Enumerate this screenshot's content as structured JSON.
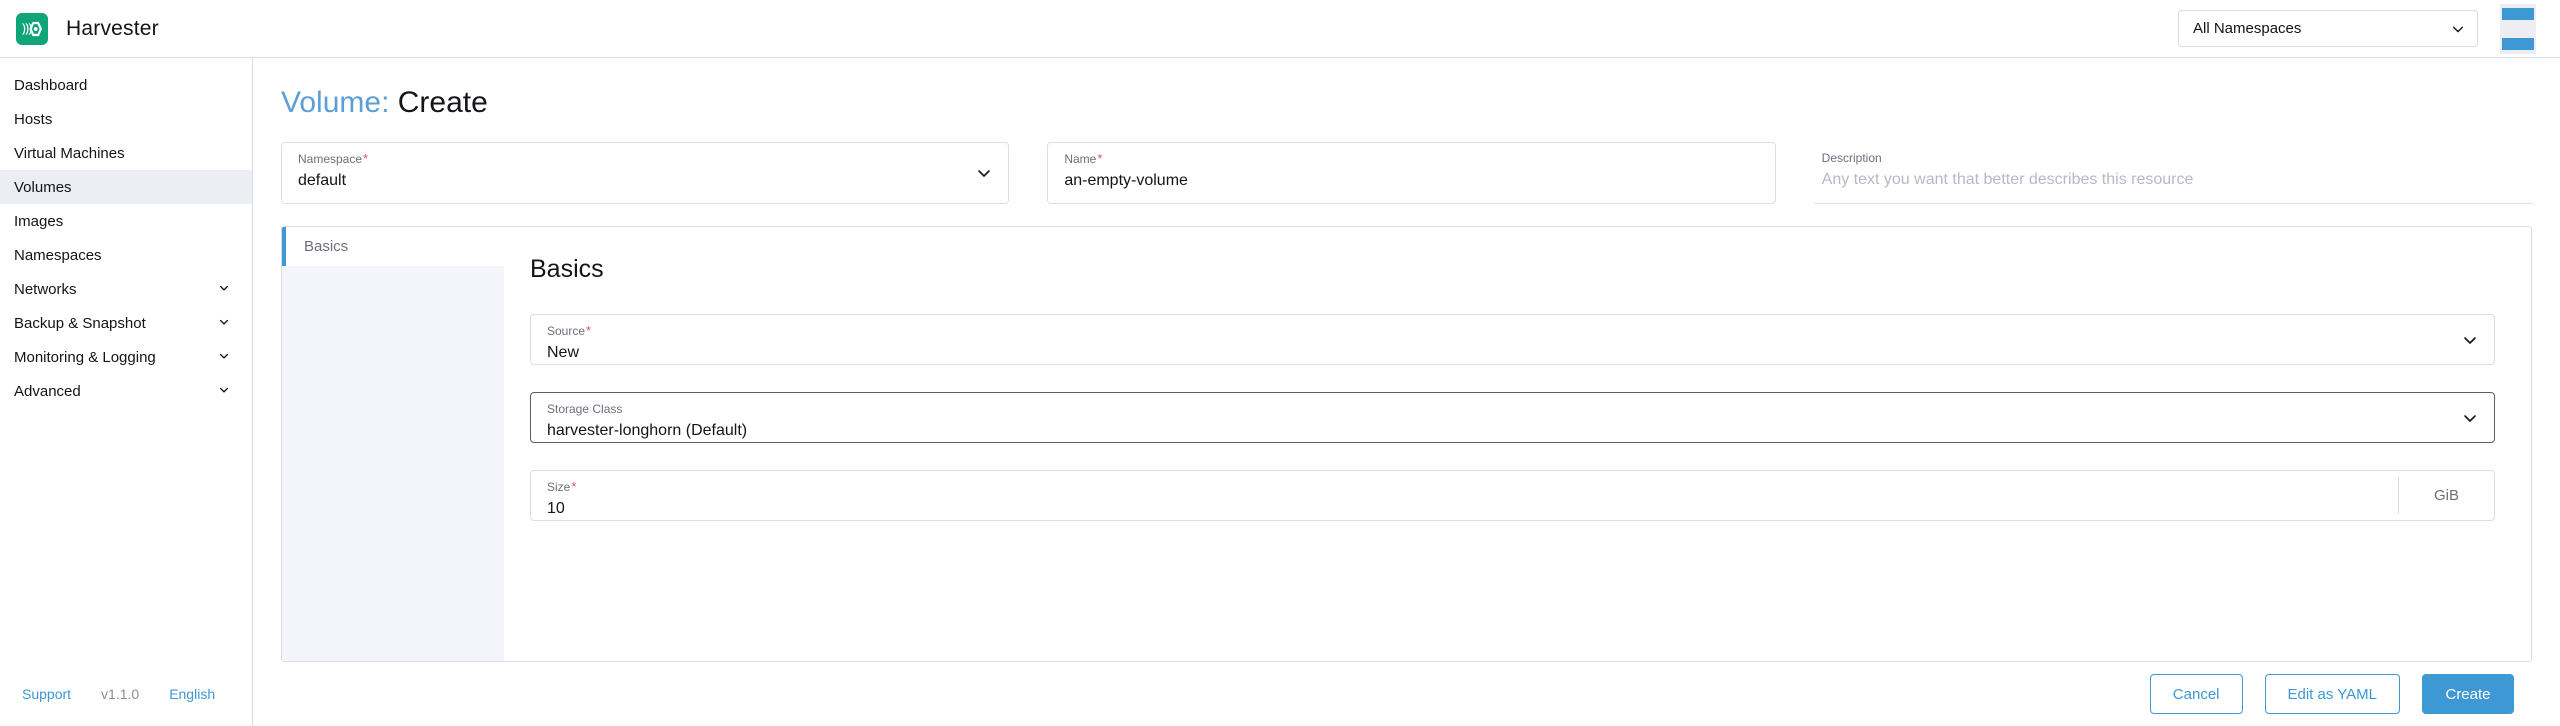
{
  "header": {
    "brand": "Harvester",
    "logo_icon": "harvester-logo-icon",
    "logo_color": "#10a578",
    "namespace_select": {
      "value": "All Namespaces",
      "chevron_icon": "chevron-down-icon"
    }
  },
  "sidebar": {
    "items": [
      {
        "label": "Dashboard",
        "active": false,
        "expandable": false
      },
      {
        "label": "Hosts",
        "active": false,
        "expandable": false
      },
      {
        "label": "Virtual Machines",
        "active": false,
        "expandable": false
      },
      {
        "label": "Volumes",
        "active": true,
        "expandable": false
      },
      {
        "label": "Images",
        "active": false,
        "expandable": false
      },
      {
        "label": "Namespaces",
        "active": false,
        "expandable": false
      },
      {
        "label": "Networks",
        "active": false,
        "expandable": true
      },
      {
        "label": "Backup & Snapshot",
        "active": false,
        "expandable": true
      },
      {
        "label": "Monitoring & Logging",
        "active": false,
        "expandable": true
      },
      {
        "label": "Advanced",
        "active": false,
        "expandable": true
      }
    ],
    "footer": {
      "support": "Support",
      "version": "v1.1.0",
      "language": "English"
    }
  },
  "page": {
    "title_resource": "Volume:",
    "title_action": "Create",
    "accent_color": "#3d98d3"
  },
  "top_fields": [
    {
      "name": "namespace",
      "label": "Namespace",
      "required": true,
      "value": "default",
      "placeholder": "",
      "type": "select",
      "chevron_icon": "chevron-down-icon"
    },
    {
      "name": "name",
      "label": "Name",
      "required": true,
      "value": "an-empty-volume",
      "placeholder": "",
      "type": "text"
    },
    {
      "name": "description",
      "label": "Description",
      "required": false,
      "value": "",
      "placeholder": "Any text you want that better describes this resource",
      "type": "text"
    }
  ],
  "tabs": [
    {
      "label": "Basics",
      "active": true
    }
  ],
  "basics": {
    "heading": "Basics",
    "fields": [
      {
        "name": "source",
        "label": "Source",
        "required": true,
        "value": "New",
        "type": "select",
        "chevron_icon": "chevron-down-icon",
        "focused": false
      },
      {
        "name": "storage-class",
        "label": "Storage Class",
        "required": false,
        "value": "harvester-longhorn (Default)",
        "type": "select",
        "chevron_icon": "chevron-down-icon",
        "focused": true
      },
      {
        "name": "size",
        "label": "Size",
        "required": true,
        "value": "10",
        "type": "text",
        "suffix": "GiB",
        "focused": false
      }
    ]
  },
  "footer_buttons": [
    {
      "name": "cancel",
      "label": "Cancel",
      "style": "secondary"
    },
    {
      "name": "edit-as-yaml",
      "label": "Edit as YAML",
      "style": "secondary"
    },
    {
      "name": "create",
      "label": "Create",
      "style": "primary"
    }
  ]
}
